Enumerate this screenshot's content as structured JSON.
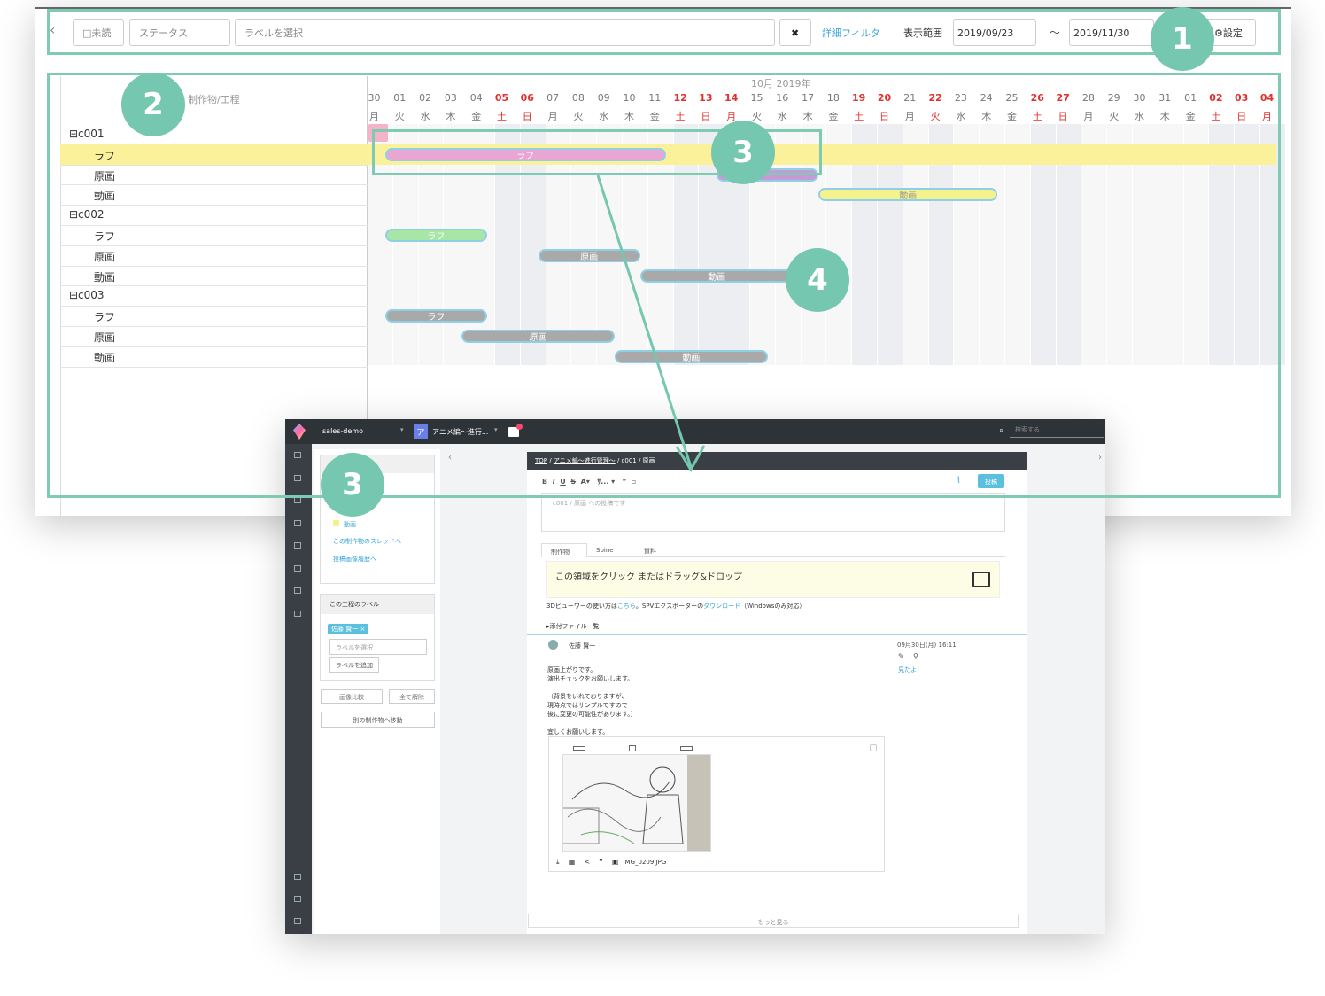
{
  "toolbar": {
    "collapse_icon": "chevron-left-icon",
    "unread_label": "□未読",
    "status_placeholder": "ステータス",
    "label_placeholder": "ラベルを選択",
    "clear_icon": "✖",
    "detail_filter": "詳細フィルタ",
    "range_label": "表示範囲",
    "date_from": "2019/09/23",
    "tilde": "〜",
    "date_to": "2019/11/30",
    "settings": "設定"
  },
  "gantt": {
    "header_label": "制作物/工程",
    "month_label": "10月 2019年",
    "days": [
      {
        "d": "30",
        "w": "月",
        "red": false
      },
      {
        "d": "01",
        "w": "火",
        "red": false
      },
      {
        "d": "02",
        "w": "水",
        "red": false
      },
      {
        "d": "03",
        "w": "木",
        "red": false
      },
      {
        "d": "04",
        "w": "金",
        "red": false
      },
      {
        "d": "05",
        "w": "土",
        "red": true
      },
      {
        "d": "06",
        "w": "日",
        "red": true
      },
      {
        "d": "07",
        "w": "月",
        "red": false
      },
      {
        "d": "08",
        "w": "火",
        "red": false
      },
      {
        "d": "09",
        "w": "水",
        "red": false
      },
      {
        "d": "10",
        "w": "木",
        "red": false
      },
      {
        "d": "11",
        "w": "金",
        "red": false
      },
      {
        "d": "12",
        "w": "土",
        "red": true
      },
      {
        "d": "13",
        "w": "日",
        "red": true
      },
      {
        "d": "14",
        "w": "月",
        "red": true
      },
      {
        "d": "15",
        "w": "火",
        "red": false
      },
      {
        "d": "16",
        "w": "水",
        "red": false
      },
      {
        "d": "17",
        "w": "木",
        "red": false
      },
      {
        "d": "18",
        "w": "金",
        "red": false
      },
      {
        "d": "19",
        "w": "土",
        "red": true
      },
      {
        "d": "20",
        "w": "日",
        "red": true
      },
      {
        "d": "21",
        "w": "月",
        "red": false
      },
      {
        "d": "22",
        "w": "火",
        "red": true
      },
      {
        "d": "23",
        "w": "水",
        "red": false
      },
      {
        "d": "24",
        "w": "木",
        "red": false
      },
      {
        "d": "25",
        "w": "金",
        "red": false
      },
      {
        "d": "26",
        "w": "土",
        "red": true
      },
      {
        "d": "27",
        "w": "日",
        "red": true
      },
      {
        "d": "28",
        "w": "月",
        "red": false
      },
      {
        "d": "29",
        "w": "火",
        "red": false
      },
      {
        "d": "30",
        "w": "水",
        "red": false
      },
      {
        "d": "31",
        "w": "木",
        "red": false
      },
      {
        "d": "01",
        "w": "金",
        "red": false
      },
      {
        "d": "02",
        "w": "土",
        "red": true
      },
      {
        "d": "03",
        "w": "日",
        "red": true
      },
      {
        "d": "04",
        "w": "月",
        "red": true
      }
    ],
    "rows": [
      {
        "label": "c001",
        "group": true
      },
      {
        "label": "ラフ",
        "group": false
      },
      {
        "label": "原画",
        "group": false
      },
      {
        "label": "動画",
        "group": false
      },
      {
        "label": "c002",
        "group": true
      },
      {
        "label": "ラフ",
        "group": false
      },
      {
        "label": "原画",
        "group": false
      },
      {
        "label": "動画",
        "group": false
      },
      {
        "label": "c003",
        "group": true
      },
      {
        "label": "ラフ",
        "group": false
      },
      {
        "label": "原画",
        "group": false
      },
      {
        "label": "動画",
        "group": false
      }
    ],
    "bars": [
      {
        "row": 1,
        "label": "ラフ",
        "start": 1,
        "end": 12,
        "color": "#e8a6d4"
      },
      {
        "row": 2,
        "label": "",
        "start": 14,
        "end": 18,
        "color": "#c79ad6"
      },
      {
        "row": 3,
        "label": "動画",
        "start": 18,
        "end": 25,
        "color": "#f4f28c"
      },
      {
        "row": 5,
        "label": "ラフ",
        "start": 1,
        "end": 5,
        "color": "#a8e6a6"
      },
      {
        "row": 6,
        "label": "原画",
        "start": 7,
        "end": 11,
        "color": "#a9a9a9"
      },
      {
        "row": 7,
        "label": "動画",
        "start": 11,
        "end": 17,
        "color": "#a9a9a9"
      },
      {
        "row": 9,
        "label": "ラフ",
        "start": 1,
        "end": 5,
        "color": "#a9a9a9"
      },
      {
        "row": 10,
        "label": "原画",
        "start": 4,
        "end": 10,
        "color": "#a9a9a9"
      },
      {
        "row": 11,
        "label": "動画",
        "start": 10,
        "end": 16,
        "color": "#a9a9a9"
      }
    ]
  },
  "badges": {
    "b1": "1",
    "b2": "2",
    "b3": "3",
    "b4": "4",
    "b3b": "3"
  },
  "app": {
    "workspace": "sales-demo",
    "project_initial": "ア",
    "project_name": "アニメ編〜進行...",
    "search_placeholder": "検索する",
    "breadcrumb_top": "TOP",
    "breadcrumb_project": "アニメ編〜進行管理〜",
    "breadcrumb_cut": "c001",
    "breadcrumb_process": "原画",
    "post_button": "投稿",
    "editor_placeholder": "c001 / 原画 への投稿です",
    "tab_work": "制作物",
    "tab_spine": "Spine",
    "tab_material": "資料",
    "drop_text": "この領域をクリック またはドラッグ&ドロップ",
    "viewer_note_1": "3Dビューワーの使い方は",
    "viewer_note_link": "こちら",
    "viewer_note_2": "。SPVエクスポーターの",
    "viewer_note_link2": "ダウンロード",
    "viewer_note_3": "（Windowsのみ対応）",
    "attachments": "添付ファイル一覧",
    "author": "佐藤 賢一",
    "post_date": "09月30日(月) 16:11",
    "seen": "見たよ！",
    "post_lines": [
      "原画上がりです。",
      "演出チェックをお願いします。",
      "",
      "（背景をいれておりますが、",
      "現時点ではサンプルですので",
      "後に変更の可能性があります。）",
      "",
      "宜しくお願いします。"
    ],
    "filename": "IMG_0209.JPG",
    "more": "もっと見る",
    "side_item_douga": "動画",
    "side_link_thread": "この制作物のスレッドへ",
    "side_link_history": "投稿画像履歴へ",
    "label_section": "この工程のラベル",
    "label_tag": "佐藤 賢一 ×",
    "label_select": "ラベルを選択",
    "label_add": "ラベルを追加",
    "compare_btn": "画像比較",
    "release_btn": "全て解除",
    "move_btn": "別の制作物へ移動"
  }
}
